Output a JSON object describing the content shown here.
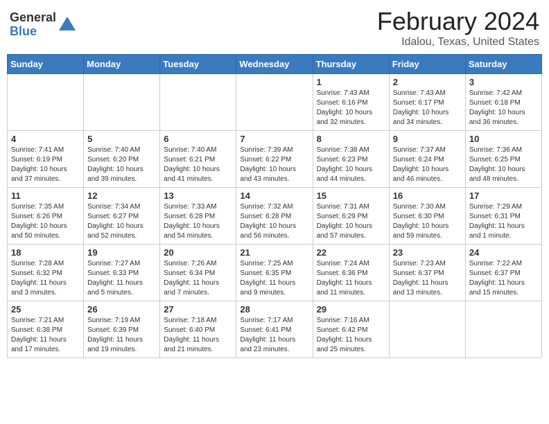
{
  "header": {
    "logo_general": "General",
    "logo_blue": "Blue",
    "title": "February 2024",
    "location": "Idalou, Texas, United States"
  },
  "days_of_week": [
    "Sunday",
    "Monday",
    "Tuesday",
    "Wednesday",
    "Thursday",
    "Friday",
    "Saturday"
  ],
  "weeks": [
    [
      {
        "day": "",
        "info": ""
      },
      {
        "day": "",
        "info": ""
      },
      {
        "day": "",
        "info": ""
      },
      {
        "day": "",
        "info": ""
      },
      {
        "day": "1",
        "info": "Sunrise: 7:43 AM\nSunset: 6:16 PM\nDaylight: 10 hours\nand 32 minutes."
      },
      {
        "day": "2",
        "info": "Sunrise: 7:43 AM\nSunset: 6:17 PM\nDaylight: 10 hours\nand 34 minutes."
      },
      {
        "day": "3",
        "info": "Sunrise: 7:42 AM\nSunset: 6:18 PM\nDaylight: 10 hours\nand 36 minutes."
      }
    ],
    [
      {
        "day": "4",
        "info": "Sunrise: 7:41 AM\nSunset: 6:19 PM\nDaylight: 10 hours\nand 37 minutes."
      },
      {
        "day": "5",
        "info": "Sunrise: 7:40 AM\nSunset: 6:20 PM\nDaylight: 10 hours\nand 39 minutes."
      },
      {
        "day": "6",
        "info": "Sunrise: 7:40 AM\nSunset: 6:21 PM\nDaylight: 10 hours\nand 41 minutes."
      },
      {
        "day": "7",
        "info": "Sunrise: 7:39 AM\nSunset: 6:22 PM\nDaylight: 10 hours\nand 43 minutes."
      },
      {
        "day": "8",
        "info": "Sunrise: 7:38 AM\nSunset: 6:23 PM\nDaylight: 10 hours\nand 44 minutes."
      },
      {
        "day": "9",
        "info": "Sunrise: 7:37 AM\nSunset: 6:24 PM\nDaylight: 10 hours\nand 46 minutes."
      },
      {
        "day": "10",
        "info": "Sunrise: 7:36 AM\nSunset: 6:25 PM\nDaylight: 10 hours\nand 48 minutes."
      }
    ],
    [
      {
        "day": "11",
        "info": "Sunrise: 7:35 AM\nSunset: 6:26 PM\nDaylight: 10 hours\nand 50 minutes."
      },
      {
        "day": "12",
        "info": "Sunrise: 7:34 AM\nSunset: 6:27 PM\nDaylight: 10 hours\nand 52 minutes."
      },
      {
        "day": "13",
        "info": "Sunrise: 7:33 AM\nSunset: 6:28 PM\nDaylight: 10 hours\nand 54 minutes."
      },
      {
        "day": "14",
        "info": "Sunrise: 7:32 AM\nSunset: 6:28 PM\nDaylight: 10 hours\nand 56 minutes."
      },
      {
        "day": "15",
        "info": "Sunrise: 7:31 AM\nSunset: 6:29 PM\nDaylight: 10 hours\nand 57 minutes."
      },
      {
        "day": "16",
        "info": "Sunrise: 7:30 AM\nSunset: 6:30 PM\nDaylight: 10 hours\nand 59 minutes."
      },
      {
        "day": "17",
        "info": "Sunrise: 7:29 AM\nSunset: 6:31 PM\nDaylight: 11 hours\nand 1 minute."
      }
    ],
    [
      {
        "day": "18",
        "info": "Sunrise: 7:28 AM\nSunset: 6:32 PM\nDaylight: 11 hours\nand 3 minutes."
      },
      {
        "day": "19",
        "info": "Sunrise: 7:27 AM\nSunset: 6:33 PM\nDaylight: 11 hours\nand 5 minutes."
      },
      {
        "day": "20",
        "info": "Sunrise: 7:26 AM\nSunset: 6:34 PM\nDaylight: 11 hours\nand 7 minutes."
      },
      {
        "day": "21",
        "info": "Sunrise: 7:25 AM\nSunset: 6:35 PM\nDaylight: 11 hours\nand 9 minutes."
      },
      {
        "day": "22",
        "info": "Sunrise: 7:24 AM\nSunset: 6:36 PM\nDaylight: 11 hours\nand 11 minutes."
      },
      {
        "day": "23",
        "info": "Sunrise: 7:23 AM\nSunset: 6:37 PM\nDaylight: 11 hours\nand 13 minutes."
      },
      {
        "day": "24",
        "info": "Sunrise: 7:22 AM\nSunset: 6:37 PM\nDaylight: 11 hours\nand 15 minutes."
      }
    ],
    [
      {
        "day": "25",
        "info": "Sunrise: 7:21 AM\nSunset: 6:38 PM\nDaylight: 11 hours\nand 17 minutes."
      },
      {
        "day": "26",
        "info": "Sunrise: 7:19 AM\nSunset: 6:39 PM\nDaylight: 11 hours\nand 19 minutes."
      },
      {
        "day": "27",
        "info": "Sunrise: 7:18 AM\nSunset: 6:40 PM\nDaylight: 11 hours\nand 21 minutes."
      },
      {
        "day": "28",
        "info": "Sunrise: 7:17 AM\nSunset: 6:41 PM\nDaylight: 11 hours\nand 23 minutes."
      },
      {
        "day": "29",
        "info": "Sunrise: 7:16 AM\nSunset: 6:42 PM\nDaylight: 11 hours\nand 25 minutes."
      },
      {
        "day": "",
        "info": ""
      },
      {
        "day": "",
        "info": ""
      }
    ]
  ]
}
